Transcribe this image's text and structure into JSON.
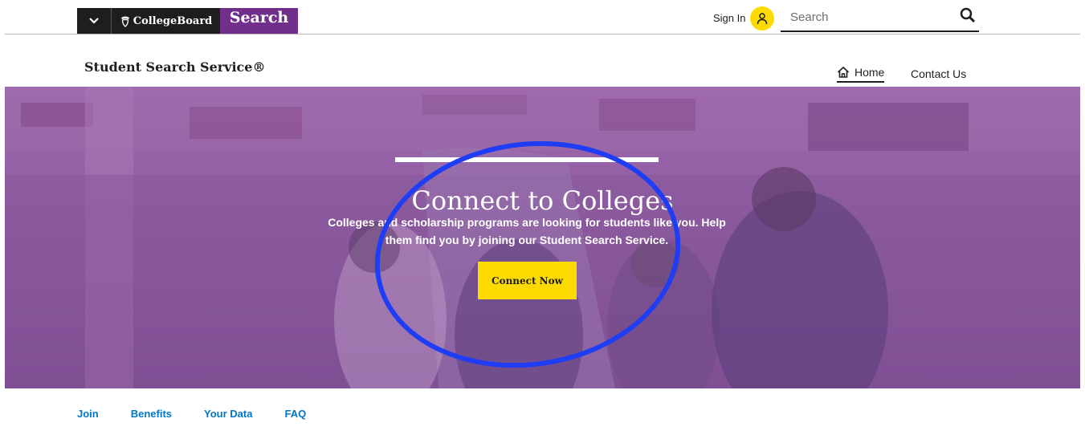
{
  "header": {
    "brand_name": "CollegeBoard",
    "product_name": "Search",
    "sign_in_label": "Sign In",
    "search_placeholder": "Search"
  },
  "site": {
    "title": "Student Search Service®",
    "nav": {
      "home": "Home",
      "contact": "Contact Us"
    }
  },
  "hero": {
    "title": "Connect to Colleges",
    "text": "Colleges and scholarship programs are looking for students like you. Help them find you by joining our Student Search Service.",
    "cta_label": "Connect Now"
  },
  "subnav": {
    "items": [
      "Join",
      "Benefits",
      "Your Data",
      "FAQ"
    ]
  },
  "colors": {
    "brand_dark": "#1e1e1e",
    "brand_purple": "#702f8a",
    "accent_yellow": "#fedb00",
    "link_blue": "#0077c8",
    "annotation_blue": "#1f3df5"
  },
  "icons": {
    "menu": "chevron-down-icon",
    "brand": "acorn-icon",
    "sign_in": "user-icon",
    "search": "search-icon",
    "home": "home-icon"
  }
}
